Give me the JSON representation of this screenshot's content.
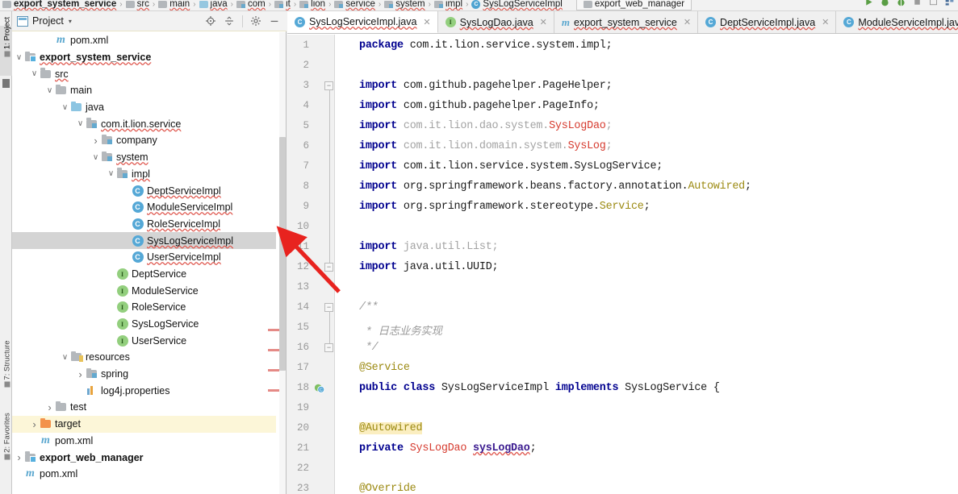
{
  "breadcrumb": {
    "items": [
      {
        "label": "export_system_service",
        "icon": "module-folder-icon",
        "bold": true
      },
      {
        "label": "src",
        "icon": "folder-icon",
        "bold": false
      },
      {
        "label": "main",
        "icon": "folder-icon",
        "bold": false
      },
      {
        "label": "java",
        "icon": "source-folder-icon",
        "bold": false
      },
      {
        "label": "com",
        "icon": "package-icon",
        "bold": false
      },
      {
        "label": "it",
        "icon": "package-icon",
        "bold": false
      },
      {
        "label": "lion",
        "icon": "package-icon",
        "bold": false
      },
      {
        "label": "service",
        "icon": "package-icon",
        "bold": false
      },
      {
        "label": "system",
        "icon": "package-icon",
        "bold": false
      },
      {
        "label": "impl",
        "icon": "package-icon",
        "bold": false
      },
      {
        "label": "SysLogServiceImpl",
        "icon": "class-icon",
        "bold": false
      }
    ],
    "run_config": "export_web_manager"
  },
  "left_tool_strip": {
    "tabs": [
      {
        "label": "1: Project",
        "active": true
      },
      {
        "label": "7: Structure",
        "active": false
      },
      {
        "label": "2: Favorites",
        "active": false
      }
    ]
  },
  "project_panel": {
    "title": "Project",
    "dropdown_caret": "▾",
    "tools": [
      {
        "name": "locate-in-tree-icon",
        "label": "Select Opened File"
      },
      {
        "name": "collapse-all-icon",
        "label": "Collapse All"
      },
      {
        "name": "gear-icon",
        "label": "Settings"
      },
      {
        "name": "minimize-icon",
        "label": "Hide"
      }
    ],
    "tree": [
      {
        "depth": 3,
        "arrow": "none",
        "icon": "maven-icon",
        "label": "pom.xml",
        "bold": false,
        "state": "normal"
      },
      {
        "depth": 1,
        "arrow": "down",
        "icon": "module-folder-icon",
        "label": "export_system_service",
        "bold": true,
        "state": "normal",
        "squiggle": true
      },
      {
        "depth": 2,
        "arrow": "down",
        "icon": "folder-icon",
        "label": "src",
        "bold": false,
        "state": "normal",
        "squiggle": true
      },
      {
        "depth": 3,
        "arrow": "down",
        "icon": "folder-icon",
        "label": "main",
        "bold": false,
        "state": "normal"
      },
      {
        "depth": 4,
        "arrow": "down",
        "icon": "source-folder-icon",
        "label": "java",
        "bold": false,
        "state": "normal"
      },
      {
        "depth": 5,
        "arrow": "down",
        "icon": "package-icon",
        "label": "com.it.lion.service",
        "bold": false,
        "state": "normal",
        "squiggle": true
      },
      {
        "depth": 6,
        "arrow": "right",
        "icon": "package-icon",
        "label": "company",
        "bold": false,
        "state": "normal"
      },
      {
        "depth": 6,
        "arrow": "down",
        "icon": "package-icon",
        "label": "system",
        "bold": false,
        "state": "normal",
        "squiggle": true
      },
      {
        "depth": 7,
        "arrow": "down",
        "icon": "package-icon",
        "label": "impl",
        "bold": false,
        "state": "normal",
        "squiggle": true
      },
      {
        "depth": 8,
        "arrow": "none",
        "icon": "class-icon",
        "label": "DeptServiceImpl",
        "bold": false,
        "state": "normal",
        "squiggle": true
      },
      {
        "depth": 8,
        "arrow": "none",
        "icon": "class-icon",
        "label": "ModuleServiceImpl",
        "bold": false,
        "state": "normal",
        "squiggle": true
      },
      {
        "depth": 8,
        "arrow": "none",
        "icon": "class-icon",
        "label": "RoleServiceImpl",
        "bold": false,
        "state": "normal",
        "squiggle": true
      },
      {
        "depth": 8,
        "arrow": "none",
        "icon": "class-icon",
        "label": "SysLogServiceImpl",
        "bold": false,
        "state": "selected",
        "squiggle": true
      },
      {
        "depth": 8,
        "arrow": "none",
        "icon": "class-icon",
        "label": "UserServiceImpl",
        "bold": false,
        "state": "normal",
        "squiggle": true
      },
      {
        "depth": 7,
        "arrow": "none",
        "icon": "interface-icon",
        "label": "DeptService",
        "bold": false,
        "state": "normal"
      },
      {
        "depth": 7,
        "arrow": "none",
        "icon": "interface-icon",
        "label": "ModuleService",
        "bold": false,
        "state": "normal"
      },
      {
        "depth": 7,
        "arrow": "none",
        "icon": "interface-icon",
        "label": "RoleService",
        "bold": false,
        "state": "normal"
      },
      {
        "depth": 7,
        "arrow": "none",
        "icon": "interface-icon",
        "label": "SysLogService",
        "bold": false,
        "state": "normal"
      },
      {
        "depth": 7,
        "arrow": "none",
        "icon": "interface-icon",
        "label": "UserService",
        "bold": false,
        "state": "normal"
      },
      {
        "depth": 4,
        "arrow": "down",
        "icon": "resources-folder-icon",
        "label": "resources",
        "bold": false,
        "state": "normal"
      },
      {
        "depth": 5,
        "arrow": "right",
        "icon": "package-icon",
        "label": "spring",
        "bold": false,
        "state": "normal"
      },
      {
        "depth": 5,
        "arrow": "none",
        "icon": "properties-icon",
        "label": "log4j.properties",
        "bold": false,
        "state": "normal"
      },
      {
        "depth": 3,
        "arrow": "right",
        "icon": "folder-icon",
        "label": "test",
        "bold": false,
        "state": "normal"
      },
      {
        "depth": 2,
        "arrow": "right",
        "icon": "target-folder-icon",
        "label": "target",
        "bold": false,
        "state": "highlighted"
      },
      {
        "depth": 2,
        "arrow": "none",
        "icon": "maven-icon",
        "label": "pom.xml",
        "bold": false,
        "state": "normal"
      },
      {
        "depth": 1,
        "arrow": "right",
        "icon": "module-folder-icon",
        "label": "export_web_manager",
        "bold": true,
        "state": "normal"
      },
      {
        "depth": 1,
        "arrow": "none",
        "icon": "maven-icon",
        "label": "pom.xml",
        "bold": false,
        "state": "normal"
      }
    ]
  },
  "editor": {
    "tabs": [
      {
        "label": "SysLogServiceImpl.java",
        "icon": "class-icon",
        "active": true,
        "closable": true
      },
      {
        "label": "SysLogDao.java",
        "icon": "interface-icon",
        "active": false,
        "closable": true
      },
      {
        "label": "export_system_service",
        "icon": "maven-icon",
        "active": false,
        "closable": true
      },
      {
        "label": "DeptServiceImpl.java",
        "icon": "class-icon",
        "active": false,
        "closable": true
      },
      {
        "label": "ModuleServiceImpl.java",
        "icon": "class-icon",
        "active": false,
        "closable": false
      }
    ],
    "first_line": 1,
    "last_line": 23,
    "lines": [
      {
        "n": 1,
        "tokens": [
          {
            "t": "package ",
            "c": "kw"
          },
          {
            "t": "com.it.lion.service.system.impl;",
            "c": ""
          }
        ]
      },
      {
        "n": 2,
        "tokens": []
      },
      {
        "n": 3,
        "tokens": [
          {
            "t": "import ",
            "c": "kw"
          },
          {
            "t": "com.github.pagehelper.PageHelper;",
            "c": ""
          }
        ]
      },
      {
        "n": 4,
        "tokens": [
          {
            "t": "import ",
            "c": "kw"
          },
          {
            "t": "com.github.pagehelper.PageInfo;",
            "c": ""
          }
        ]
      },
      {
        "n": 5,
        "tokens": [
          {
            "t": "import ",
            "c": "kw"
          },
          {
            "t": "com.it.lion.dao.system.",
            "c": "gray"
          },
          {
            "t": "SysLogDao",
            "c": "red"
          },
          {
            "t": ";",
            "c": "gray"
          }
        ]
      },
      {
        "n": 6,
        "tokens": [
          {
            "t": "import ",
            "c": "kw"
          },
          {
            "t": "com.it.lion.domain.system.",
            "c": "gray"
          },
          {
            "t": "SysLog",
            "c": "red"
          },
          {
            "t": ";",
            "c": "gray"
          }
        ]
      },
      {
        "n": 7,
        "tokens": [
          {
            "t": "import ",
            "c": "kw"
          },
          {
            "t": "com.it.lion.service.system.SysLogService;",
            "c": ""
          }
        ]
      },
      {
        "n": 8,
        "tokens": [
          {
            "t": "import ",
            "c": "kw"
          },
          {
            "t": "org.springframework.beans.factory.annotation.",
            "c": ""
          },
          {
            "t": "Autowired",
            "c": "olive"
          },
          {
            "t": ";",
            "c": ""
          }
        ]
      },
      {
        "n": 9,
        "tokens": [
          {
            "t": "import ",
            "c": "kw"
          },
          {
            "t": "org.springframework.stereotype.",
            "c": ""
          },
          {
            "t": "Service",
            "c": "olive"
          },
          {
            "t": ";",
            "c": ""
          }
        ]
      },
      {
        "n": 10,
        "tokens": []
      },
      {
        "n": 11,
        "tokens": [
          {
            "t": "import ",
            "c": "kw"
          },
          {
            "t": "java.util.List;",
            "c": "gray"
          }
        ]
      },
      {
        "n": 12,
        "tokens": [
          {
            "t": "import ",
            "c": "kw"
          },
          {
            "t": "java.util.UUID;",
            "c": ""
          }
        ]
      },
      {
        "n": 13,
        "tokens": []
      },
      {
        "n": 14,
        "tokens": [
          {
            "t": "/**",
            "c": "cmt"
          }
        ]
      },
      {
        "n": 15,
        "tokens": [
          {
            "t": " * 日志业务实现",
            "c": "cmt"
          }
        ]
      },
      {
        "n": 16,
        "tokens": [
          {
            "t": " */",
            "c": "cmt"
          }
        ]
      },
      {
        "n": 17,
        "tokens": [
          {
            "t": "@Service",
            "c": "olive"
          }
        ]
      },
      {
        "n": 18,
        "tokens": [
          {
            "t": "public class ",
            "c": "kw"
          },
          {
            "t": "SysLogServiceImpl ",
            "c": ""
          },
          {
            "t": "implements ",
            "c": "kw"
          },
          {
            "t": "SysLogService {",
            "c": ""
          }
        ]
      },
      {
        "n": 19,
        "tokens": []
      },
      {
        "n": 20,
        "tokens": [
          {
            "t": "@Autowired",
            "c": "olive hlbg"
          }
        ]
      },
      {
        "n": 21,
        "tokens": [
          {
            "t": "private ",
            "c": "kw"
          },
          {
            "t": "SysLogDao ",
            "c": "red"
          },
          {
            "t": "sysLogDao",
            "c": "purple fieldu"
          },
          {
            "t": ";",
            "c": ""
          }
        ]
      },
      {
        "n": 22,
        "tokens": []
      },
      {
        "n": 23,
        "tokens": [
          {
            "t": "@Override",
            "c": "olive"
          }
        ]
      }
    ],
    "fold_lines": [
      3,
      12,
      14,
      16
    ],
    "gutter_marker_line": 18,
    "gutter_marker_name": "implementing-method-icon"
  },
  "annotation": {
    "type": "red-arrow",
    "points_to": "SysLogServiceImpl",
    "color": "#e8231f"
  },
  "colors": {
    "accent_blue": "#55a8d6",
    "interface_green": "#93cf7e",
    "selection_gray": "#d4d4d4",
    "highlight_yellow": "#fcf6d8",
    "keyword_blue": "#00008f",
    "string_red": "#d63b2f",
    "annotation_olive": "#9c8a12"
  }
}
